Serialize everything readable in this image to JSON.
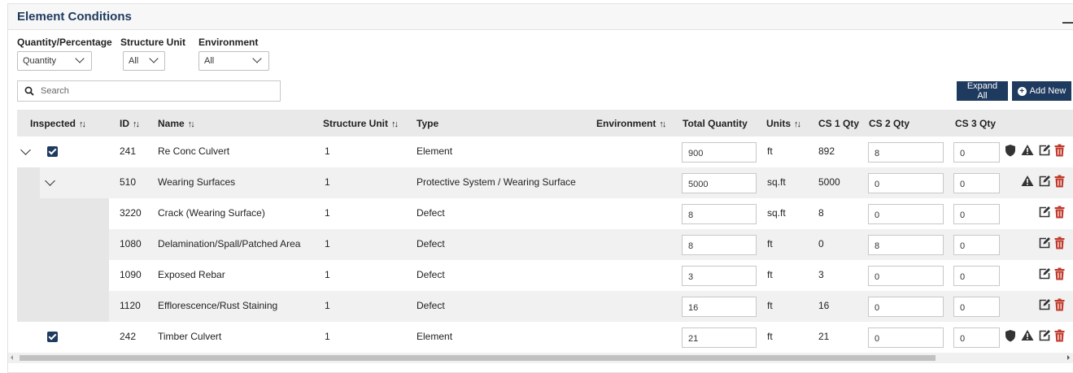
{
  "panel": {
    "title": "Element Conditions"
  },
  "filters": {
    "quantity_label": "Quantity/Percentage",
    "quantity_value": "Quantity",
    "unit_label": "Structure Unit",
    "unit_value": "All",
    "env_label": "Environment",
    "env_value": "All"
  },
  "search": {
    "placeholder": "Search"
  },
  "buttons": {
    "expand_all": "Expand All",
    "add_new": "Add New"
  },
  "columns": {
    "inspected": "Inspected",
    "id": "ID",
    "name": "Name",
    "structure_unit": "Structure Unit",
    "type": "Type",
    "environment": "Environment",
    "total_quantity": "Total Quantity",
    "units": "Units",
    "cs1": "CS 1 Qty",
    "cs2": "CS 2 Qty",
    "cs3": "CS 3 Qty"
  },
  "rows": [
    {
      "id": "241",
      "name": "Re Conc Culvert",
      "unit": "1",
      "type": "Element",
      "total": "900",
      "units": "ft",
      "cs1": "892",
      "cs2": "8",
      "cs3": "0",
      "inspected": true
    },
    {
      "id": "510",
      "name": "Wearing Surfaces",
      "unit": "1",
      "type": "Protective System / Wearing Surface",
      "total": "5000",
      "units": "sq.ft",
      "cs1": "5000",
      "cs2": "0",
      "cs3": "0"
    },
    {
      "id": "3220",
      "name": "Crack (Wearing Surface)",
      "unit": "1",
      "type": "Defect",
      "total": "8",
      "units": "sq.ft",
      "cs1": "8",
      "cs2": "0",
      "cs3": "0"
    },
    {
      "id": "1080",
      "name": "Delamination/Spall/Patched Area",
      "unit": "1",
      "type": "Defect",
      "total": "8",
      "units": "ft",
      "cs1": "0",
      "cs2": "8",
      "cs3": "0"
    },
    {
      "id": "1090",
      "name": "Exposed Rebar",
      "unit": "1",
      "type": "Defect",
      "total": "3",
      "units": "ft",
      "cs1": "3",
      "cs2": "0",
      "cs3": "0"
    },
    {
      "id": "1120",
      "name": "Efflorescence/Rust Staining",
      "unit": "1",
      "type": "Defect",
      "total": "16",
      "units": "ft",
      "cs1": "16",
      "cs2": "0",
      "cs3": "0"
    },
    {
      "id": "242",
      "name": "Timber Culvert",
      "unit": "1",
      "type": "Element",
      "total": "21",
      "units": "ft",
      "cs1": "21",
      "cs2": "0",
      "cs3": "0",
      "inspected": true
    }
  ],
  "colors": {
    "accent": "#1e3a5f",
    "delete": "#c0392b",
    "header_bg": "#e9e9e9"
  },
  "icons": [
    "search-icon",
    "shield-icon",
    "warning-icon",
    "edit-icon",
    "trash-icon",
    "chevron-down-icon",
    "plus-circle-icon",
    "sort-icon"
  ]
}
